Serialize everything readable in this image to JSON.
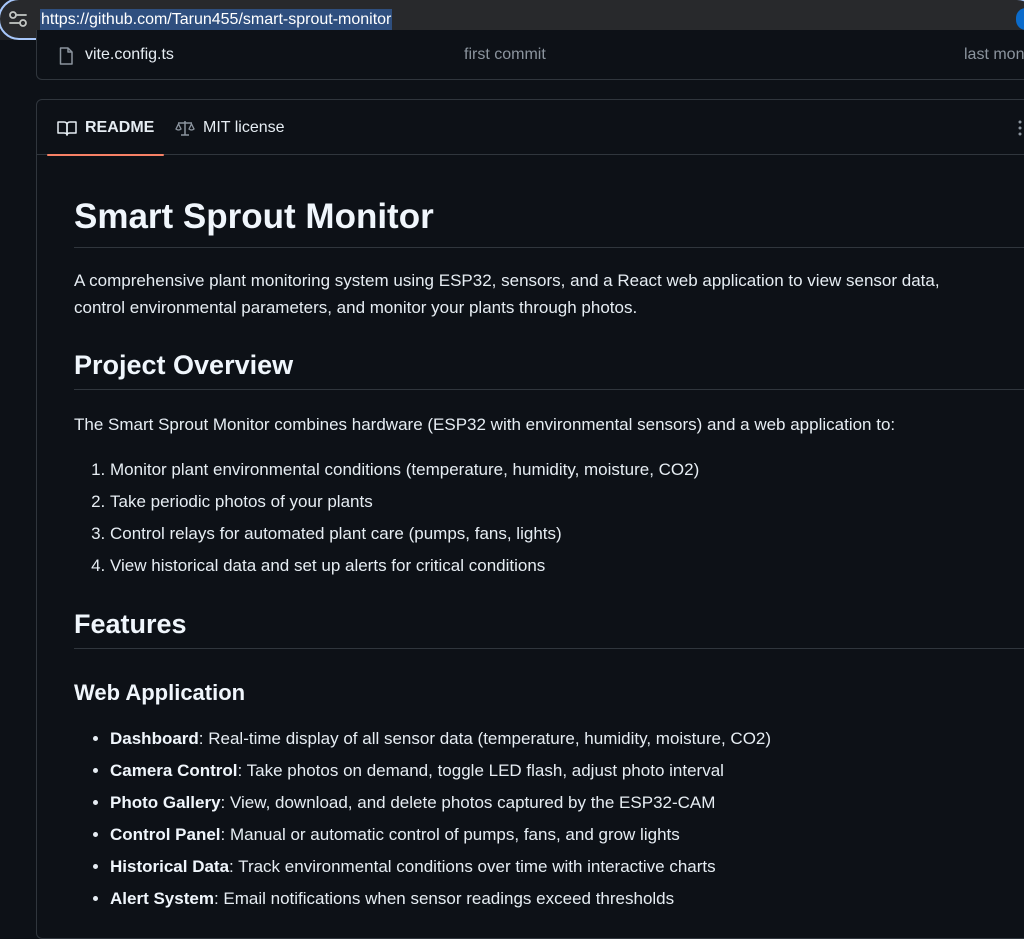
{
  "browser": {
    "url": "https://github.com/Tarun455/smart-sprout-monitor"
  },
  "file_row": {
    "name": "vite.config.ts",
    "commit": "first commit",
    "date": "last mon"
  },
  "readme_tabs": {
    "readme": "README",
    "license": "MIT license"
  },
  "readme": {
    "title": "Smart Sprout Monitor",
    "intro_line1": "A comprehensive plant monitoring system using ESP32, sensors, and a React web application to view sensor data,",
    "intro_line2": "control environmental parameters, and monitor your plants through photos.",
    "overview_heading": "Project Overview",
    "overview_text": "The Smart Sprout Monitor combines hardware (ESP32 with environmental sensors) and a web application to:",
    "overview_items": [
      "Monitor plant environmental conditions (temperature, humidity, moisture, CO2)",
      "Take periodic photos of your plants",
      "Control relays for automated plant care (pumps, fans, lights)",
      "View historical data and set up alerts for critical conditions"
    ],
    "features_heading": "Features",
    "webapp_heading": "Web Application",
    "webapp_items": [
      {
        "label": "Dashboard",
        "text": ": Real-time display of all sensor data (temperature, humidity, moisture, CO2)"
      },
      {
        "label": "Camera Control",
        "text": ": Take photos on demand, toggle LED flash, adjust photo interval"
      },
      {
        "label": "Photo Gallery",
        "text": ": View, download, and delete photos captured by the ESP32-CAM"
      },
      {
        "label": "Control Panel",
        "text": ": Manual or automatic control of pumps, fans, and grow lights"
      },
      {
        "label": "Historical Data",
        "text": ": Track environmental conditions over time with interactive charts"
      },
      {
        "label": "Alert System",
        "text": ": Email notifications when sensor readings exceed thresholds"
      }
    ]
  }
}
